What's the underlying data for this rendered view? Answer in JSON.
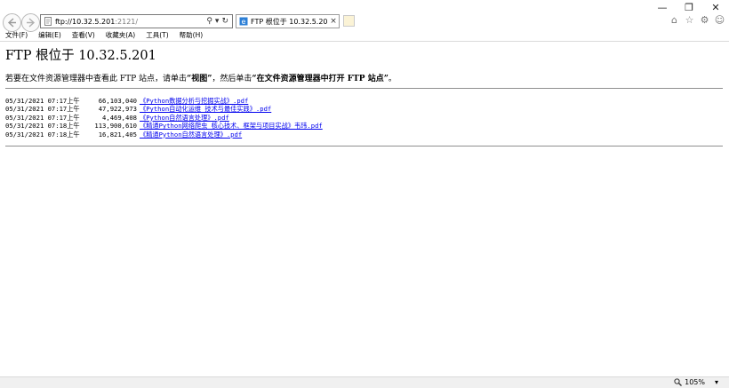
{
  "window": {
    "minimize": "—",
    "restore": "❐",
    "close": "✕"
  },
  "toolbar": {
    "back_icon": "arrow-left",
    "forward_icon": "arrow-right",
    "address_host": "ftp://10.32.5.201",
    "address_port_path": ":2121/",
    "search_glyph": "⚲",
    "dropdown_glyph": "▾",
    "refresh_glyph": "↻"
  },
  "tab": {
    "title": "FTP 根位于 10.32.5.201",
    "close": "×"
  },
  "right_icons": {
    "home": "⌂",
    "favorites": "☆",
    "settings": "⚙",
    "feedback": "☺"
  },
  "menu": [
    "文件(F)",
    "编辑(E)",
    "查看(V)",
    "收藏夹(A)",
    "工具(T)",
    "帮助(H)"
  ],
  "page": {
    "title": "FTP 根位于 10.32.5.201",
    "intro_prefix": "若要在文件资源管理器中查看此 FTP 站点，请单击",
    "intro_view": "“视图”",
    "intro_middle": "，然后单击",
    "intro_open": "“在文件资源管理器中打开 FTP 站点”",
    "intro_end": "。"
  },
  "files": [
    {
      "datetime": "05/31/2021 07:17上午",
      "size": "66,103,040",
      "name": "《Python数据分析与挖掘实战》.pdf"
    },
    {
      "datetime": "05/31/2021 07:17上午",
      "size": "47,922,973",
      "name": "《Python自动化运维 技术与最佳实践》.pdf"
    },
    {
      "datetime": "05/31/2021 07:17上午",
      "size": "4,469,408",
      "name": "《Python自然语言处理》.pdf"
    },
    {
      "datetime": "05/31/2021 07:18上午",
      "size": "113,900,610",
      "name": "《精通Python网络爬虫 核心技术、框架与项目实战》韦玮.pdf"
    },
    {
      "datetime": "05/31/2021 07:18上午",
      "size": "16,821,405",
      "name": "《精通Python自然语言处理》.pdf"
    }
  ],
  "status": {
    "zoom": "105%",
    "zoom_dropdown": "▾"
  },
  "colors": {
    "link": "#0000ee",
    "status_bar": "#f0f0f0"
  }
}
